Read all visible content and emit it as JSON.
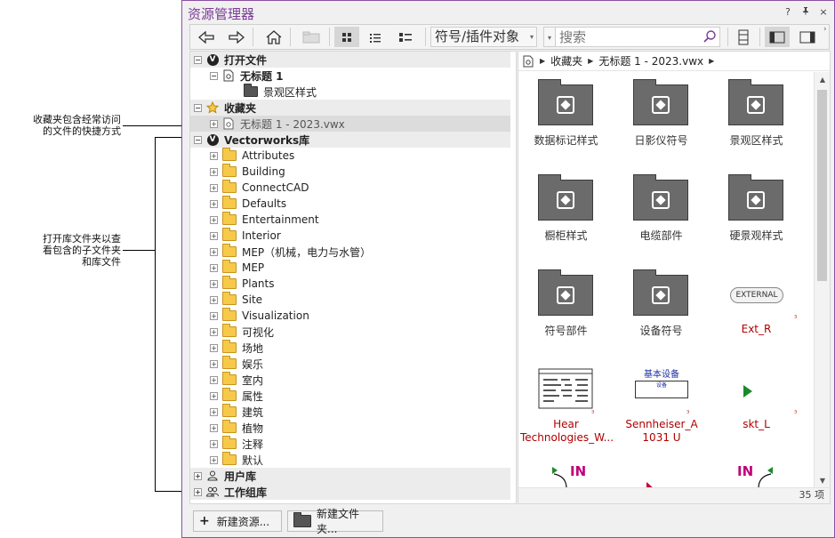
{
  "callouts": {
    "favorites": "收藏夹包含经常访问的文件的快捷方式",
    "favorites_line1": "收藏夹包含经常访问",
    "favorites_line2": "的文件的快捷方式",
    "library_line1": "打开库文件夹以查",
    "library_line2": "看包含的子文件夹",
    "library_line3": "和库文件"
  },
  "window": {
    "title": "资源管理器",
    "controls": [
      "?",
      "ᵖ",
      "×"
    ]
  },
  "toolbar": {
    "back_icon": "arrow-left-icon",
    "forward_icon": "arrow-right-icon",
    "home_icon": "home-icon",
    "dropdown_value": "符号/插件对象",
    "search_placeholder": "搜索"
  },
  "tree": {
    "open_files": {
      "label": "打开文件",
      "items": [
        {
          "label": "无标题 1",
          "children": [
            {
              "label": "景观区样式"
            }
          ]
        }
      ]
    },
    "favorites": {
      "label": "收藏夹",
      "items": [
        {
          "label": "无标题 1 - 2023.vwx"
        }
      ]
    },
    "vw_library": {
      "label": "Vectorworks库",
      "items": [
        "Attributes",
        "Building",
        "ConnectCAD",
        "Defaults",
        "Entertainment",
        "Interior",
        "MEP（机械，电力与水管）",
        "MEP",
        "Plants",
        "Site",
        "Visualization",
        "可视化",
        "场地",
        "娱乐",
        "室内",
        "属性",
        "建筑",
        "植物",
        "注释",
        "默认"
      ]
    },
    "user_library": {
      "label": "用户库"
    },
    "workgroup_library": {
      "label": "工作组库"
    }
  },
  "right_panel": {
    "breadcrumb": [
      "收藏夹",
      "无标题 1 - 2023.vwx"
    ],
    "items": [
      {
        "label": "数据标记样式",
        "kind": "folder"
      },
      {
        "label": "日影仪符号",
        "kind": "folder"
      },
      {
        "label": "景观区样式",
        "kind": "folder"
      },
      {
        "label": "橱柜样式",
        "kind": "folder"
      },
      {
        "label": "电缆部件",
        "kind": "folder"
      },
      {
        "label": "硬景观样式",
        "kind": "folder"
      },
      {
        "label": "符号部件",
        "kind": "folder"
      },
      {
        "label": "设备符号",
        "kind": "folder"
      },
      {
        "label": "Ext_R",
        "kind": "symbol-external"
      },
      {
        "label": "Hear Technologies_W...",
        "kind": "symbol-panel"
      },
      {
        "label": "Sennheiser_A 1031 U",
        "kind": "symbol-basic"
      },
      {
        "label": "skt_L",
        "kind": "symbol-triangle"
      }
    ],
    "external_tag": "EXTERNAL",
    "basic_device_text": "基本设备",
    "basic_device_sub": "设备",
    "in_label": "IN",
    "item_count": "35 项"
  },
  "bottom": {
    "new_resource": "新建资源...",
    "new_folder": "新建文件夹..."
  },
  "colors": {
    "accent": "#7a3a96",
    "red_text": "#b00000",
    "folder_dark": "#6b6b6b"
  }
}
